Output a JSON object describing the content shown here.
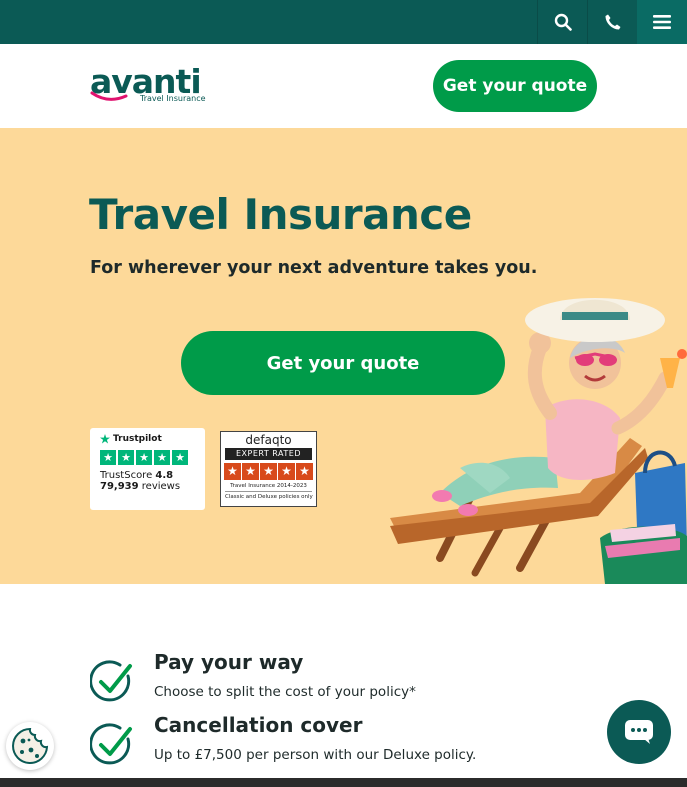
{
  "topbar": {
    "search_icon": "search-icon",
    "phone_icon": "phone-icon",
    "menu_icon": "hamburger-menu-icon"
  },
  "header": {
    "logo_word": "avanti",
    "logo_sub": "Travel Insurance",
    "quote_label": "Get your quote"
  },
  "hero": {
    "title": "Travel Insurance",
    "subtitle": "For wherever your next adventure takes you.",
    "quote_label": "Get your quote",
    "trustpilot": {
      "brand": "Trustpilot",
      "score_label": "TrustScore",
      "score": "4.8",
      "reviews_count": "79,939",
      "reviews_label": "reviews",
      "rating_stars": 5
    },
    "defaqto": {
      "name": "defaqto",
      "badge": "EXPERT RATED",
      "stars": 5,
      "line1": "Travel Insurance 2014-2023",
      "line2": "Classic and Deluxe policies only"
    }
  },
  "features": [
    {
      "title": "Pay your way",
      "desc": "Choose to split the cost of your policy*"
    },
    {
      "title": "Cancellation cover",
      "desc": "Up to £7,500 per person with our Deluxe policy."
    }
  ],
  "colors": {
    "brand_teal": "#0b5a55",
    "brand_green": "#009b49",
    "hero_bg": "#fdd999",
    "trustpilot_green": "#00b67a",
    "defaqto_orange": "#d84a1b"
  }
}
